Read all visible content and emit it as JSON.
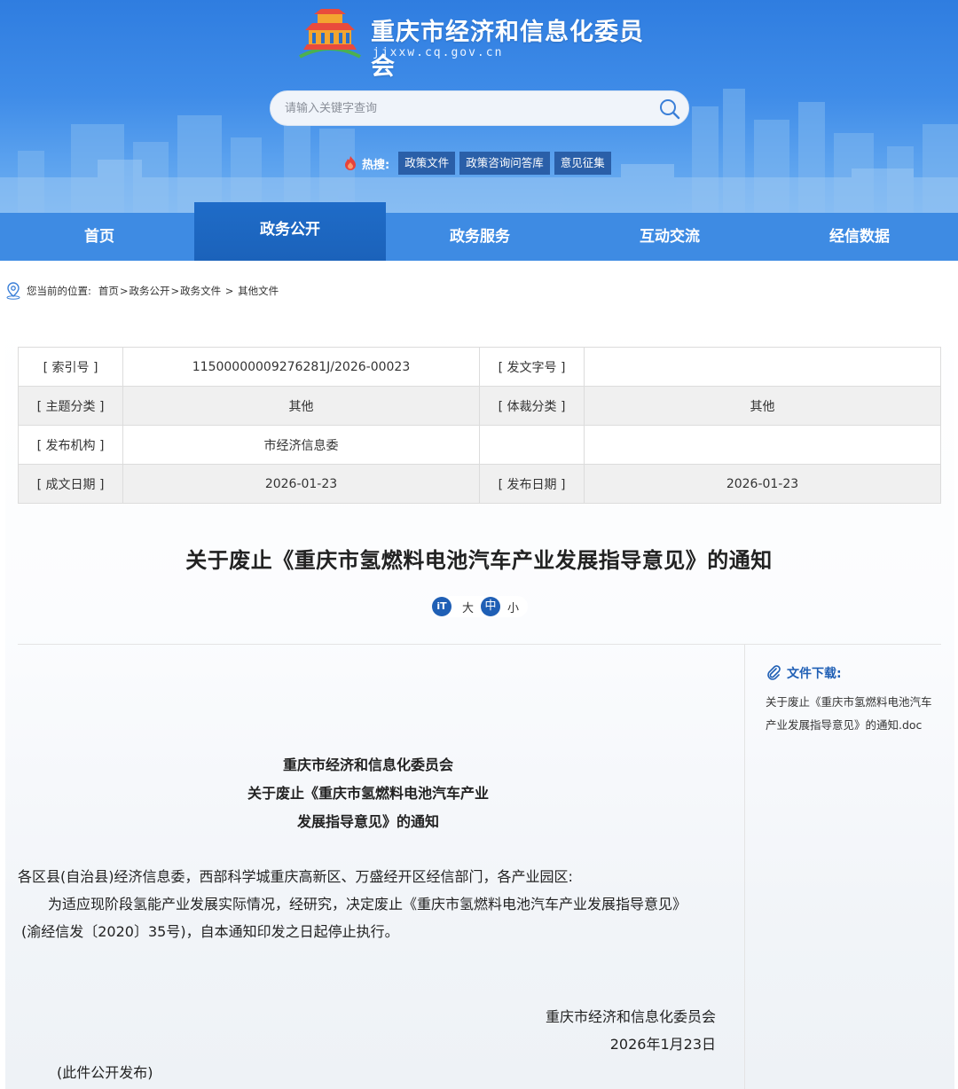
{
  "header": {
    "site_title": "重庆市经济和信息化委员会",
    "site_domain": "jjxxw.cq.gov.cn",
    "search_placeholder": "请输入关键字查询",
    "hot_label": "热搜:",
    "hot_tags": [
      "政策文件",
      "政策咨询问答库",
      "意见征集"
    ]
  },
  "nav": {
    "items": [
      "首页",
      "政务公开",
      "政务服务",
      "互动交流",
      "经信数据"
    ],
    "active": "政务公开"
  },
  "breadcrumb": {
    "prefix": "您当前的位置:",
    "items": [
      "首页",
      "政务公开",
      "政务文件",
      "其他文件"
    ]
  },
  "meta": {
    "rows": [
      {
        "k1": "[ 索引号 ]",
        "v1": "11500000009276281J/2026-00023",
        "k2": "[ 发文字号 ]",
        "v2": ""
      },
      {
        "k1": "[ 主题分类 ]",
        "v1": "其他",
        "k2": "[ 体裁分类 ]",
        "v2": "其他"
      },
      {
        "k1": "[ 发布机构 ]",
        "v1": "市经济信息委",
        "k2": "",
        "v2": ""
      },
      {
        "k1": "[ 成文日期 ]",
        "v1": "2026-01-23",
        "k2": "[ 发布日期 ]",
        "v2": "2026-01-23"
      }
    ]
  },
  "doc": {
    "title": "关于废止《重庆市氢燃料电池汽车产业发展指导意见》的通知",
    "font_icon": "iT",
    "font_sizes": [
      "大",
      "中",
      "小"
    ],
    "heading_lines": [
      "重庆市经济和信息化委员会",
      "关于废止《重庆市氢燃料电池汽车产业",
      "发展指导意见》的通知"
    ],
    "addressee": "各区县(自治县)经济信息委，西部科学城重庆高新区、万盛经开区经信部门，各产业园区:",
    "para1_line1": "为适应现阶段氢能产业发展实际情况，经研究，决定废止《重庆市氢燃料电池汽车产业发展指导意见》",
    "para1_line2": "(渝经信发〔2020〕35号)，自本通知印发之日起停止执行。",
    "sign_org": "重庆市经济和信息化委员会",
    "sign_date": "2026年1月23日",
    "note": "(此件公开发布)"
  },
  "download": {
    "title": "文件下载:",
    "file_line1": "关于废止《重庆市氢燃料电池汽车",
    "file_line2": "产业发展指导意见》的通知.doc"
  },
  "colors": {
    "header_blue": "#3e8be3",
    "nav_active": "#1f6cc8",
    "accent": "#1f5fb5",
    "hot_tag_bg": "#2a5fa8"
  }
}
